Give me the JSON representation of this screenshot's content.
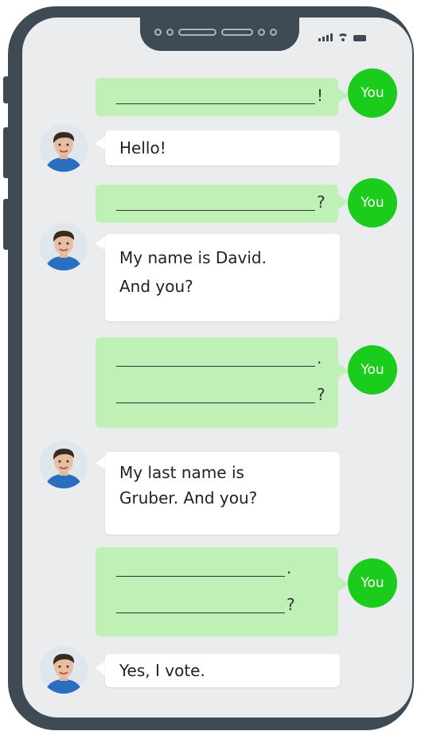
{
  "user_label": "You",
  "messages": [
    {
      "from": "you",
      "punct": "!"
    },
    {
      "from": "david",
      "text_lines": [
        "Hello!"
      ]
    },
    {
      "from": "you",
      "punct": "?"
    },
    {
      "from": "david",
      "text_lines": [
        "My name is David.",
        "And you?"
      ]
    },
    {
      "from": "you",
      "lines": [
        {
          "punct": "."
        },
        {
          "punct": "?"
        }
      ]
    },
    {
      "from": "david",
      "text_lines": [
        "My last name is",
        "Gruber. And you?"
      ]
    },
    {
      "from": "you",
      "lines": [
        {
          "punct": "."
        },
        {
          "punct": "?"
        }
      ]
    },
    {
      "from": "david",
      "text_lines": [
        "Yes, I vote."
      ]
    }
  ],
  "colors": {
    "phone_frame": "#3e4b55",
    "screen_bg": "#ebeced",
    "outgoing_bubble": "#bff0b6",
    "you_avatar": "#1ccc1c",
    "incoming_bubble": "#ffffff"
  },
  "icons": [
    "signal-icon",
    "wifi-icon",
    "battery-icon",
    "david-avatar"
  ]
}
